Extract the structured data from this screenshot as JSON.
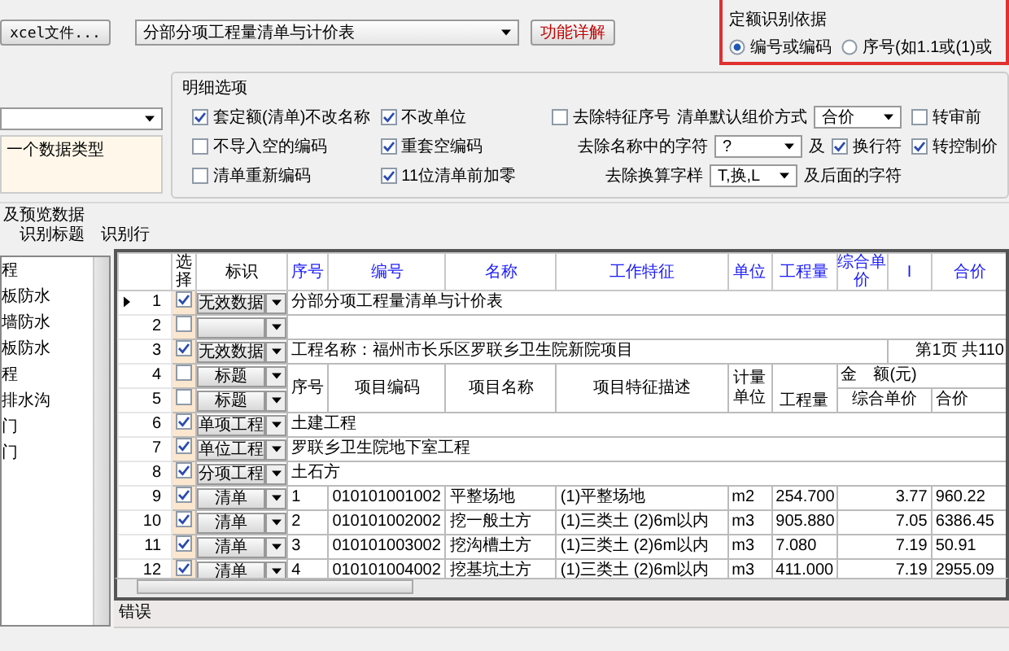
{
  "toolbar": {
    "file_button": "xcel文件...",
    "sheet_select": "分部分项工程量清单与计价表",
    "help_button": "功能详解"
  },
  "quota_basis": {
    "title": "定额识别依据",
    "options": [
      {
        "label": "编号或编码",
        "selected": true
      },
      {
        "label": "序号(如1.1或(1)或",
        "selected": false
      }
    ]
  },
  "type_note": "一个数据类型",
  "details": {
    "title": "明细选项",
    "left_checks": [
      {
        "label": "套定额(清单)不改名称",
        "checked": true
      },
      {
        "label": "不导入空的编码",
        "checked": false
      },
      {
        "label": "清单重新编码",
        "checked": false
      }
    ],
    "middle_checks": [
      {
        "label": "不改单位",
        "checked": true
      },
      {
        "label": "重套空编码",
        "checked": true
      },
      {
        "label": "11位清单前加零",
        "checked": true
      }
    ],
    "filters": [
      [
        {
          "kind": "check",
          "label": "去除特征序号",
          "checked": false
        },
        {
          "kind": "select",
          "label": "清单默认组价方式",
          "value": "合价"
        }
      ],
      [
        {
          "kind": "select",
          "label": "去除名称中的字符",
          "value": "?"
        },
        {
          "kind": "text",
          "label": "及"
        },
        {
          "kind": "check",
          "label": "换行符",
          "checked": true
        }
      ],
      [
        {
          "kind": "select",
          "label": "去除换算字样",
          "value": "T,换,L"
        },
        {
          "kind": "text",
          "label": "及后面的字符"
        }
      ]
    ],
    "right_checks": [
      {
        "label": "转审前",
        "checked": false
      },
      {
        "label": "转控制价",
        "checked": true
      }
    ]
  },
  "preview": {
    "title": "及预览数据",
    "tabs": [
      {
        "label": "识别标题",
        "selected": false
      },
      {
        "label": "识别行",
        "selected": false
      }
    ]
  },
  "tree": {
    "items": [
      "程",
      "板防水",
      "墙防水",
      "板防水",
      "程",
      "排水沟",
      "门",
      "门"
    ]
  },
  "grid": {
    "columns": [
      "选择",
      "标识",
      "序号",
      "编号",
      "名称",
      "工作特征",
      "单位",
      "工程量",
      "综合单价",
      "I",
      "合价"
    ],
    "rows": [
      {
        "num": "1",
        "current": true,
        "checked": true,
        "tag": "无效数据",
        "kind": "merged",
        "text": "分部分项工程量清单与计价表"
      },
      {
        "num": "2",
        "current": false,
        "checked": false,
        "kind": "blank"
      },
      {
        "num": "3",
        "current": false,
        "checked": true,
        "tag": "无效数据",
        "kind": "split",
        "text": "工程名称：福州市长乐区罗联乡卫生院新院项目",
        "page": "第1页 共110"
      },
      {
        "num": "4",
        "current": false,
        "checked": false,
        "tag": "标题",
        "kind": "header_top",
        "cells": [
          "序号",
          "项目编码",
          "项目名称",
          "项目特征描述",
          "计量单位",
          "工程量",
          "金　额(元)"
        ]
      },
      {
        "num": "5",
        "current": false,
        "checked": false,
        "tag": "标题",
        "kind": "header_bottom",
        "cells": [
          "综合单价",
          "合价"
        ]
      },
      {
        "num": "6",
        "current": false,
        "checked": true,
        "tag": "单项工程",
        "kind": "merged",
        "text": "土建工程"
      },
      {
        "num": "7",
        "current": false,
        "checked": true,
        "tag": "单位工程",
        "kind": "merged",
        "text": "罗联乡卫生院地下室工程"
      },
      {
        "num": "8",
        "current": false,
        "checked": true,
        "tag": "分项工程",
        "kind": "merged",
        "text": "土石方"
      },
      {
        "num": "9",
        "current": false,
        "checked": true,
        "tag": "清单",
        "kind": "item",
        "cells": [
          "1",
          "010101001002",
          "平整场地",
          "(1)平整场地",
          "m2",
          "254.700",
          "3.77",
          "960.22"
        ]
      },
      {
        "num": "10",
        "current": false,
        "checked": true,
        "tag": "清单",
        "kind": "item",
        "cells": [
          "2",
          "010101002002",
          "挖一般土方",
          "(1)三类土 (2)6m以内",
          "m3",
          "905.880",
          "7.05",
          "6386.45"
        ]
      },
      {
        "num": "11",
        "current": false,
        "checked": true,
        "tag": "清单",
        "kind": "item",
        "cells": [
          "3",
          "010101003002",
          "挖沟槽土方",
          "(1)三类土 (2)6m以内",
          "m3",
          "7.080",
          "7.19",
          "50.91"
        ]
      },
      {
        "num": "12",
        "current": false,
        "checked": true,
        "tag": "清单",
        "kind": "item",
        "cells": [
          "4",
          "010101004002",
          "挖基坑土方",
          "(1)三类土 (2)6m以内",
          "m3",
          "411.000",
          "7.19",
          "2955.09"
        ]
      }
    ]
  },
  "error_label": "错误"
}
